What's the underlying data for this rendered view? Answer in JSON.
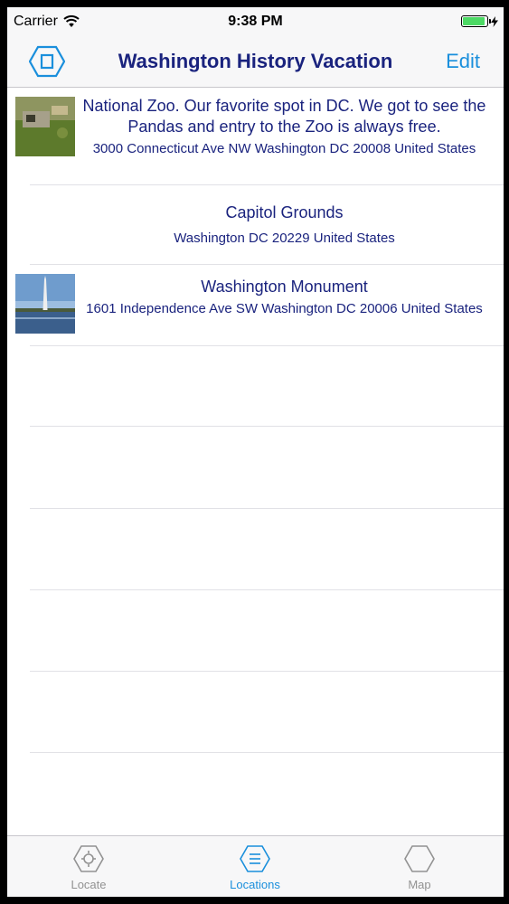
{
  "status_bar": {
    "carrier": "Carrier",
    "time": "9:38 PM",
    "battery_level": 0.95
  },
  "nav_bar": {
    "title": "Washington History Vacation",
    "edit_label": "Edit",
    "left_icon": "hexagon-square-icon"
  },
  "locations": [
    {
      "title": "National Zoo.  Our favorite spot in DC.  We got to see the Pandas and entry to the Zoo is always free.",
      "address": "3000 Connecticut Ave NW Washington DC 20008 United States",
      "has_thumbnail": true
    },
    {
      "title": "Capitol Grounds",
      "address": "Washington DC 20229 United States",
      "has_thumbnail": false
    },
    {
      "title": "Washington Monument",
      "address": "1601 Independence Ave SW Washington DC 20006 United States",
      "has_thumbnail": true
    }
  ],
  "tab_bar": {
    "tabs": [
      {
        "label": "Locate",
        "icon": "hexagon-gear-icon",
        "active": false
      },
      {
        "label": "Locations",
        "icon": "hexagon-list-icon",
        "active": true
      },
      {
        "label": "Map",
        "icon": "hexagon-icon",
        "active": false
      }
    ]
  },
  "colors": {
    "title_text": "#1a237e",
    "accent": "#1a8fdc",
    "inactive_tab": "#929292"
  }
}
